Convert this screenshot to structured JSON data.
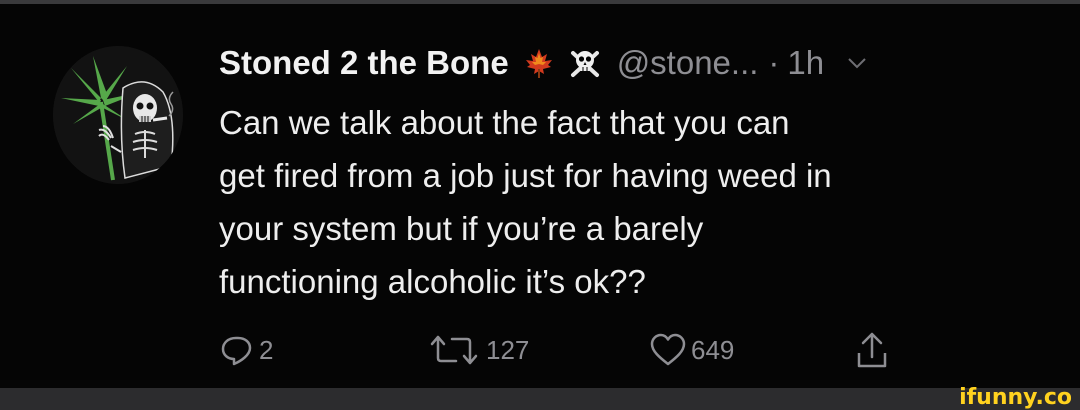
{
  "tweet": {
    "display_name": "Stoned 2 the Bone",
    "handle": "@stone...",
    "separator": "·",
    "time": "1h",
    "text_lines": [
      "Can we talk about the fact that you can",
      "get fired from a job just for having weed in",
      "your system but if you’re a barely",
      "functioning alcoholic it’s ok??"
    ],
    "emojis": [
      "maple-leaf-icon",
      "skull-and-crossbones-icon"
    ]
  },
  "actions": {
    "reply_count": "2",
    "retweet_count": "127",
    "like_count": "649"
  },
  "watermark": "ifunny.co",
  "colors": {
    "background": "#050505",
    "text": "#eeeeee",
    "muted": "#8e8e93",
    "watermark": "#ffd21f",
    "leaf": "#56a84a"
  }
}
